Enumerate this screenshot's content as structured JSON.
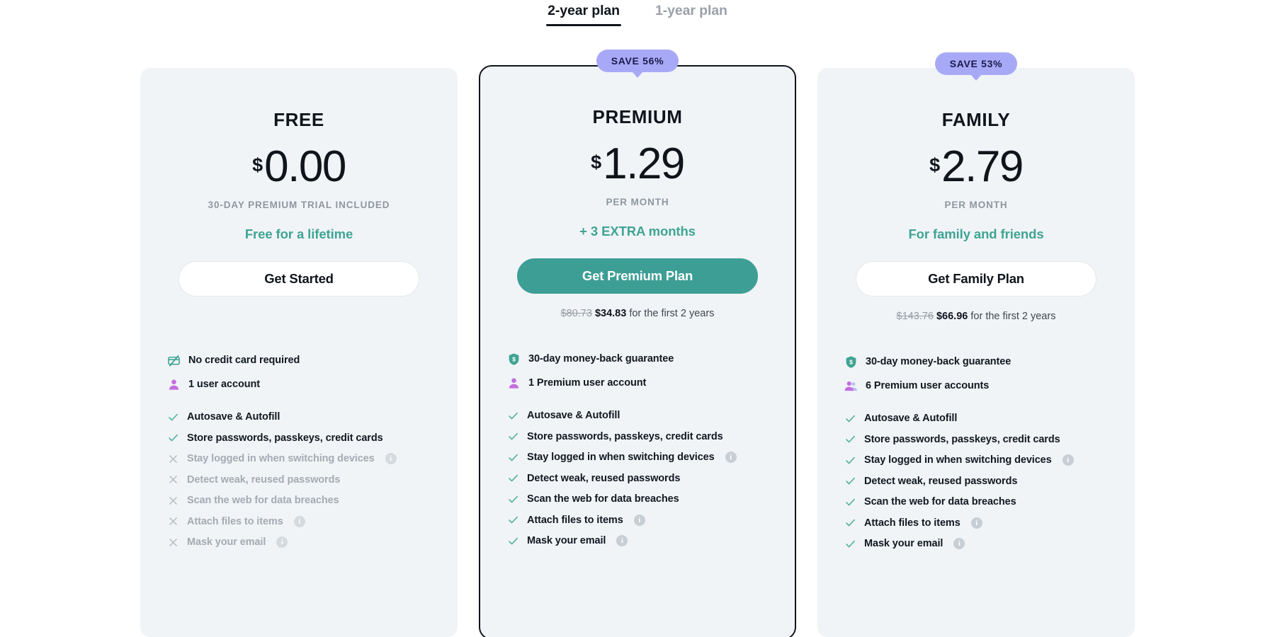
{
  "tabs": [
    {
      "label": "2-year plan",
      "active": true
    },
    {
      "label": "1-year plan",
      "active": false
    }
  ],
  "colors": {
    "card_bg": "#f1f4f7",
    "accent_teal": "#3fa493",
    "button_teal": "#3d9e95",
    "badge_lavender": "#a8a9f6",
    "badge_text": "#1b1b4d",
    "text_dark": "#10151c",
    "text_muted": "#8e979f",
    "text_disabled": "#a4abb2"
  },
  "plans": [
    {
      "id": "free",
      "name": "FREE",
      "badge": null,
      "currency": "$",
      "amount": "0.00",
      "period": "30-DAY PREMIUM TRIAL INCLUDED",
      "tagline": "Free for a lifetime",
      "cta_label": "Get Started",
      "cta_style": "outline",
      "subprice": null,
      "highlights": [
        {
          "icon": "no-credit-card-icon",
          "text": "No credit card required"
        },
        {
          "icon": "single-user-icon",
          "text": "1 user account"
        }
      ],
      "features": [
        {
          "text": "Autosave & Autofill",
          "included": true,
          "info": false
        },
        {
          "text": "Store passwords, passkeys, credit cards",
          "included": true,
          "info": false
        },
        {
          "text": "Stay logged in when switching devices",
          "included": false,
          "info": true
        },
        {
          "text": "Detect weak, reused passwords",
          "included": false,
          "info": false
        },
        {
          "text": "Scan the web for data breaches",
          "included": false,
          "info": false
        },
        {
          "text": "Attach files to items",
          "included": false,
          "info": true
        },
        {
          "text": "Mask your email",
          "included": false,
          "info": true
        }
      ]
    },
    {
      "id": "premium",
      "name": "PREMIUM",
      "featured": true,
      "badge": "SAVE 56%",
      "currency": "$",
      "amount": "1.29",
      "period": "PER MONTH",
      "tagline": "+ 3 EXTRA months",
      "cta_label": "Get Premium Plan",
      "cta_style": "primary",
      "subprice": {
        "old": "$80.73",
        "new": "$34.83",
        "rest": "for the first 2 years"
      },
      "highlights": [
        {
          "icon": "money-back-shield-icon",
          "text": "30-day money-back guarantee"
        },
        {
          "icon": "single-user-icon",
          "text": "1 Premium user account"
        }
      ],
      "features": [
        {
          "text": "Autosave & Autofill",
          "included": true,
          "info": false
        },
        {
          "text": "Store passwords, passkeys, credit cards",
          "included": true,
          "info": false
        },
        {
          "text": "Stay logged in when switching devices",
          "included": true,
          "info": true
        },
        {
          "text": "Detect weak, reused passwords",
          "included": true,
          "info": false
        },
        {
          "text": "Scan the web for data breaches",
          "included": true,
          "info": false
        },
        {
          "text": "Attach files to items",
          "included": true,
          "info": true
        },
        {
          "text": "Mask your email",
          "included": true,
          "info": true
        }
      ]
    },
    {
      "id": "family",
      "name": "FAMILY",
      "badge": "SAVE 53%",
      "currency": "$",
      "amount": "2.79",
      "period": "PER MONTH",
      "tagline": "For family and friends",
      "cta_label": "Get Family Plan",
      "cta_style": "outline",
      "subprice": {
        "old": "$143.76",
        "new": "$66.96",
        "rest": "for the first 2 years"
      },
      "highlights": [
        {
          "icon": "money-back-shield-icon",
          "text": "30-day money-back guarantee"
        },
        {
          "icon": "multi-user-icon",
          "text": "6 Premium user accounts"
        }
      ],
      "features": [
        {
          "text": "Autosave & Autofill",
          "included": true,
          "info": false
        },
        {
          "text": "Store passwords, passkeys, credit cards",
          "included": true,
          "info": false
        },
        {
          "text": "Stay logged in when switching devices",
          "included": true,
          "info": true
        },
        {
          "text": "Detect weak, reused passwords",
          "included": true,
          "info": false
        },
        {
          "text": "Scan the web for data breaches",
          "included": true,
          "info": false
        },
        {
          "text": "Attach files to items",
          "included": true,
          "info": true
        },
        {
          "text": "Mask your email",
          "included": true,
          "info": true
        }
      ]
    }
  ],
  "info_glyph": "i"
}
